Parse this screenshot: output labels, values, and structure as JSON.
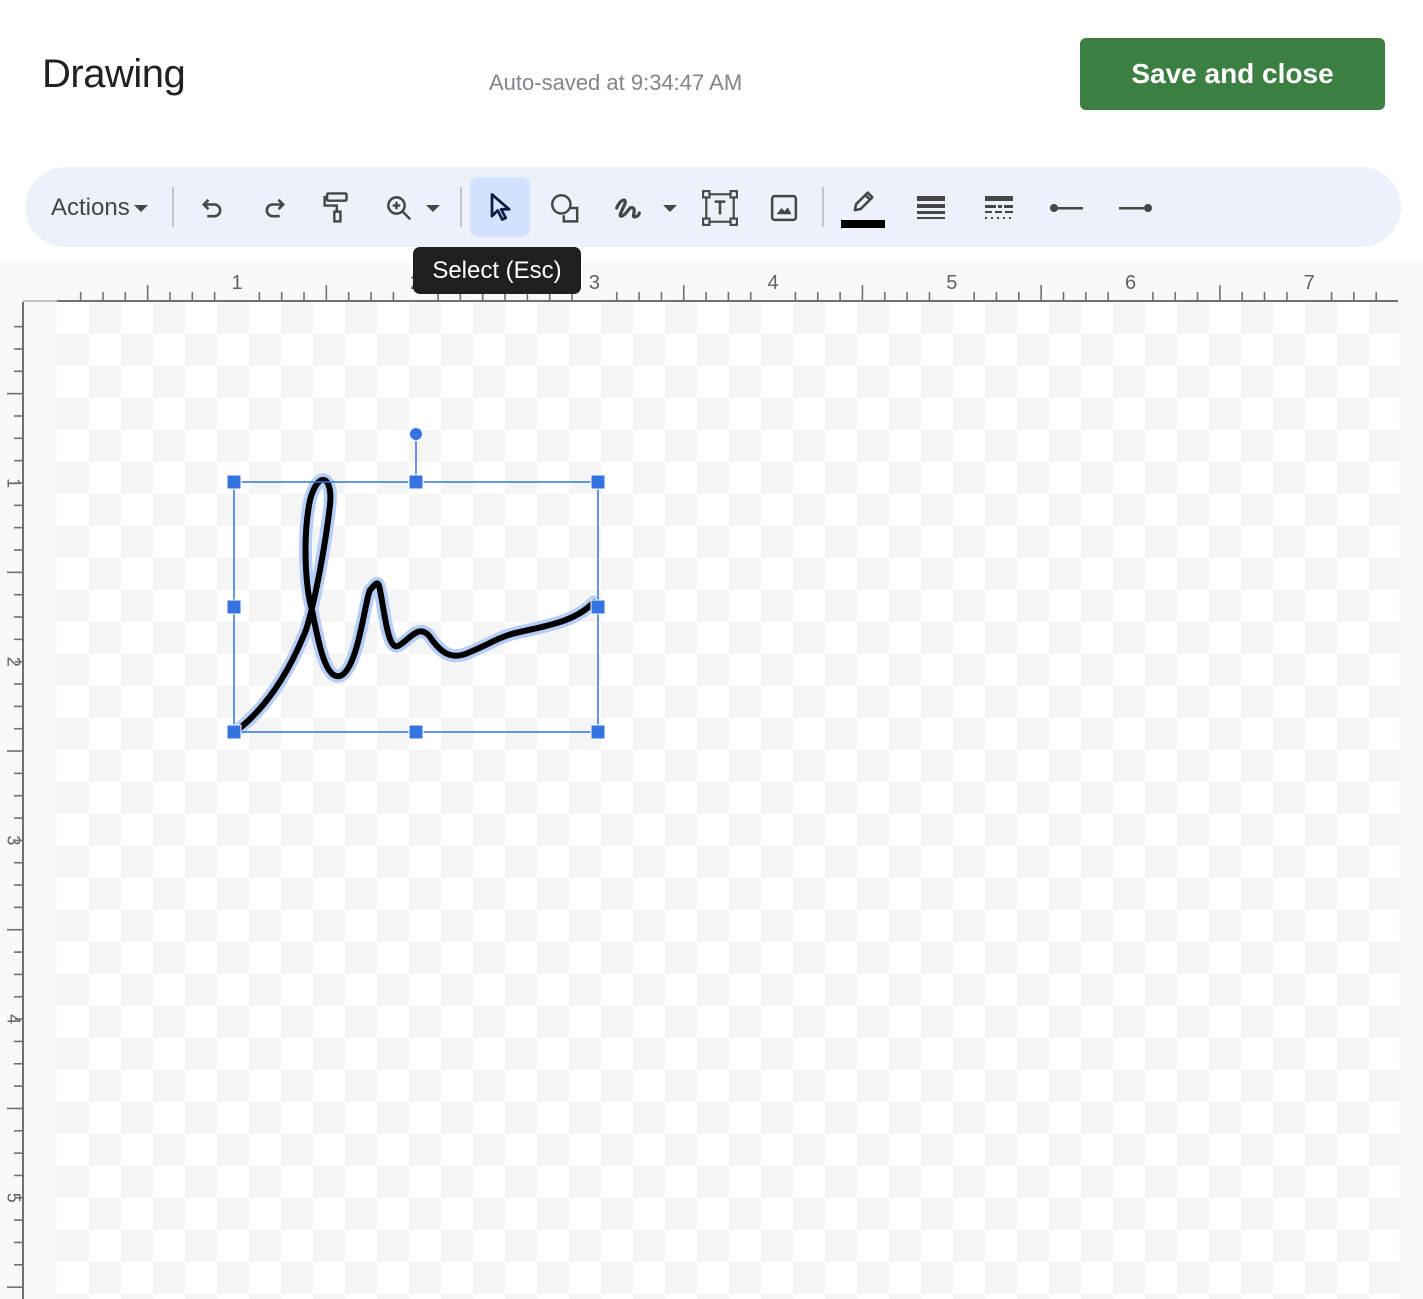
{
  "header": {
    "title": "Drawing",
    "autosave_status": "Auto-saved at 9:34:47 AM",
    "save_close_label": "Save and close"
  },
  "toolbar": {
    "actions_label": "Actions",
    "items": [
      {
        "name": "undo",
        "icon": "undo-icon"
      },
      {
        "name": "redo",
        "icon": "redo-icon"
      },
      {
        "name": "paint-format",
        "icon": "paint-roller-icon"
      },
      {
        "name": "zoom",
        "icon": "zoom-in-icon",
        "has_dropdown": true
      },
      {
        "name": "select",
        "icon": "cursor-arrow-icon",
        "active": true
      },
      {
        "name": "shape",
        "icon": "shape-icon"
      },
      {
        "name": "line",
        "icon": "scribble-icon",
        "has_dropdown": true
      },
      {
        "name": "text-box",
        "icon": "text-box-icon"
      },
      {
        "name": "image",
        "icon": "image-icon"
      },
      {
        "name": "line-color",
        "icon": "pencil-icon",
        "current_color": "#000000"
      },
      {
        "name": "line-weight",
        "icon": "line-weight-icon"
      },
      {
        "name": "line-dash",
        "icon": "line-dash-icon"
      },
      {
        "name": "line-start",
        "icon": "line-start-icon"
      },
      {
        "name": "line-end",
        "icon": "line-end-icon"
      }
    ],
    "tooltip": "Select (Esc)"
  },
  "ruler": {
    "horizontal_labels": [
      "1",
      "2",
      "3",
      "4",
      "5",
      "6",
      "7"
    ],
    "vertical_labels": [
      "1",
      "2",
      "3",
      "4",
      "5"
    ],
    "unit": "inch"
  },
  "colors": {
    "accent": "#3b7f42",
    "selection": "#3574e0",
    "stroke": "#000000",
    "stroke_highlight": "#b6cdf5"
  }
}
